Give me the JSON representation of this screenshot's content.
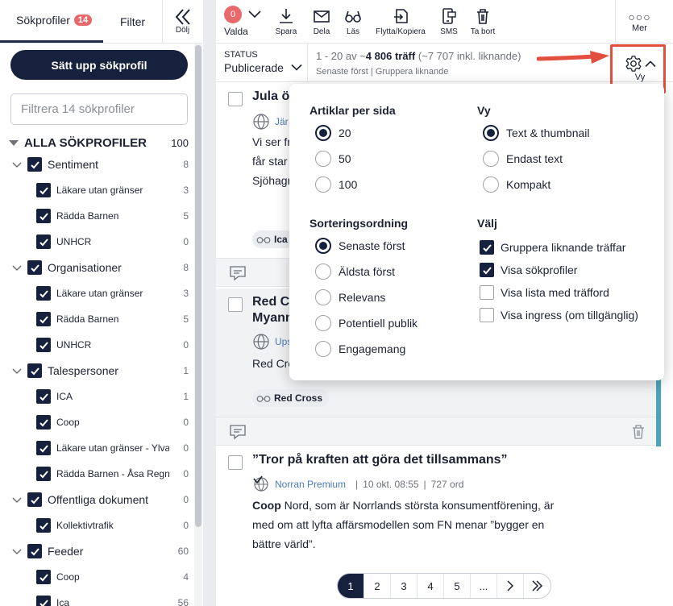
{
  "sidebar": {
    "tab_profiles": "Sökprofiler",
    "tab_profiles_count": "14",
    "tab_filter": "Filter",
    "hide_label": "Dölj",
    "setup_button": "Sätt upp sökprofil",
    "filter_placeholder": "Filtrera 14 sökprofiler",
    "all_label": "ALLA SÖKPROFILER",
    "all_count": "100",
    "rows": [
      {
        "label": "Sentiment",
        "count": "8"
      },
      {
        "label": "Läkare utan gränser",
        "count": "3"
      },
      {
        "label": "Rädda Barnen",
        "count": "5"
      },
      {
        "label": "UNHCR",
        "count": "0"
      },
      {
        "label": "Organisationer",
        "count": "8"
      },
      {
        "label": "Läkare utan gränser",
        "count": "3"
      },
      {
        "label": "Rädda Barnen",
        "count": "5"
      },
      {
        "label": "UNHCR",
        "count": "0"
      },
      {
        "label": "Talespersoner",
        "count": "1"
      },
      {
        "label": "ICA",
        "count": "1"
      },
      {
        "label": "Coop",
        "count": "0"
      },
      {
        "label": "Läkare utan gränser - Ylva ...",
        "count": "0"
      },
      {
        "label": "Rädda Barnen - Åsa Regnér",
        "count": "0"
      },
      {
        "label": "Offentliga dokument",
        "count": "0"
      },
      {
        "label": "Kollektivtrafik",
        "count": "0"
      },
      {
        "label": "Feeder",
        "count": "60"
      },
      {
        "label": "Coop",
        "count": "4"
      },
      {
        "label": "Ica",
        "count": "56"
      }
    ]
  },
  "toolbar": {
    "selected_count": "0",
    "selected_label": "Valda",
    "save": "Spara",
    "share": "Dela",
    "read": "Läs",
    "move_copy": "Flytta/Kopiera",
    "sms": "SMS",
    "delete": "Ta bort",
    "more": "Mer"
  },
  "statusbar": {
    "status_key": "STATUS",
    "status_value": "Publicerade",
    "range": "1 - 20 av ~",
    "hits": "4 806 träff",
    "similar": "(~7 707 inkl. liknande)",
    "sort_info": "Senaste först",
    "group_info": "Gruppera liknande",
    "view_label": "Vy"
  },
  "articles": [
    {
      "title": "Jula öp",
      "source": "Jär",
      "text1": "Vi ser fr",
      "text2": "får star",
      "text3": "Sjöhagr",
      "tag": "Ica"
    },
    {
      "title": "Red Cr",
      "title2": "Myann",
      "source": "Ups",
      "text1": "Red Cro",
      "tag": "Red Cross"
    },
    {
      "title": "”Tror på kraften att göra det tillsammans”",
      "source": "Norran Premium",
      "date": "10 okt. 08:55",
      "words": "727 ord",
      "text_bold": "Coop",
      "text1": " Nord, som är Norrlands största konsumentförening, är",
      "text2": "med om att lyfta affärsmodellen som FN menar ”bygger en",
      "text3": "bättre värld”."
    }
  ],
  "pager": {
    "pages": [
      "1",
      "2",
      "3",
      "4",
      "5",
      "..."
    ],
    "active": "1"
  },
  "view_menu": {
    "per_page_heading": "Artiklar per sida",
    "per_page": [
      "20",
      "50",
      "100"
    ],
    "view_heading": "Vy",
    "views": [
      "Text & thumbnail",
      "Endast text",
      "Kompakt"
    ],
    "sort_heading": "Sorteringsordning",
    "sorts": [
      "Senaste först",
      "Äldsta först",
      "Relevans",
      "Potentiell publik",
      "Engagemang"
    ],
    "choose_heading": "Välj",
    "choices": [
      "Gruppera liknande träffar",
      "Visa sökprofiler",
      "Visa lista med träfford",
      "Visa ingress (om tillgänglig)"
    ]
  },
  "colors": {
    "navy": "#16213e",
    "badge": "#e8696c",
    "highlight": "#e2503d"
  }
}
